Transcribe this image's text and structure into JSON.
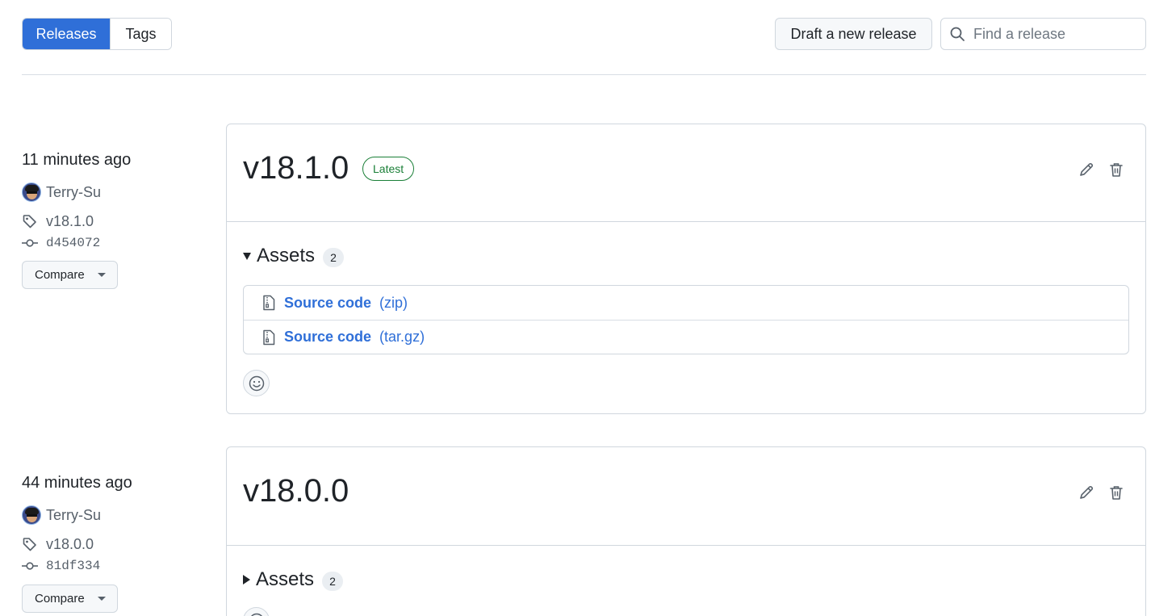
{
  "tabs": [
    {
      "label": "Releases",
      "active": true
    },
    {
      "label": "Tags",
      "active": false
    }
  ],
  "actions": {
    "draft_label": "Draft a new release",
    "search_placeholder": "Find a release"
  },
  "releases": [
    {
      "time": "11 minutes ago",
      "author": "Terry-Su",
      "tag": "v18.1.0",
      "commit": "d454072",
      "compare_label": "Compare",
      "title": "v18.1.0",
      "badge": "Latest",
      "assets_label": "Assets",
      "assets_count": "2",
      "assets_expanded": true,
      "assets": [
        {
          "name": "Source code",
          "ext": "(zip)"
        },
        {
          "name": "Source code",
          "ext": "(tar.gz)"
        }
      ]
    },
    {
      "time": "44 minutes ago",
      "author": "Terry-Su",
      "tag": "v18.0.0",
      "commit": "81df334",
      "compare_label": "Compare",
      "title": "v18.0.0",
      "assets_label": "Assets",
      "assets_count": "2",
      "assets_expanded": false
    }
  ],
  "colors": {
    "accent": "#2f6fd8",
    "latest_badge": "#1a7f37",
    "border": "#d0d7de"
  }
}
